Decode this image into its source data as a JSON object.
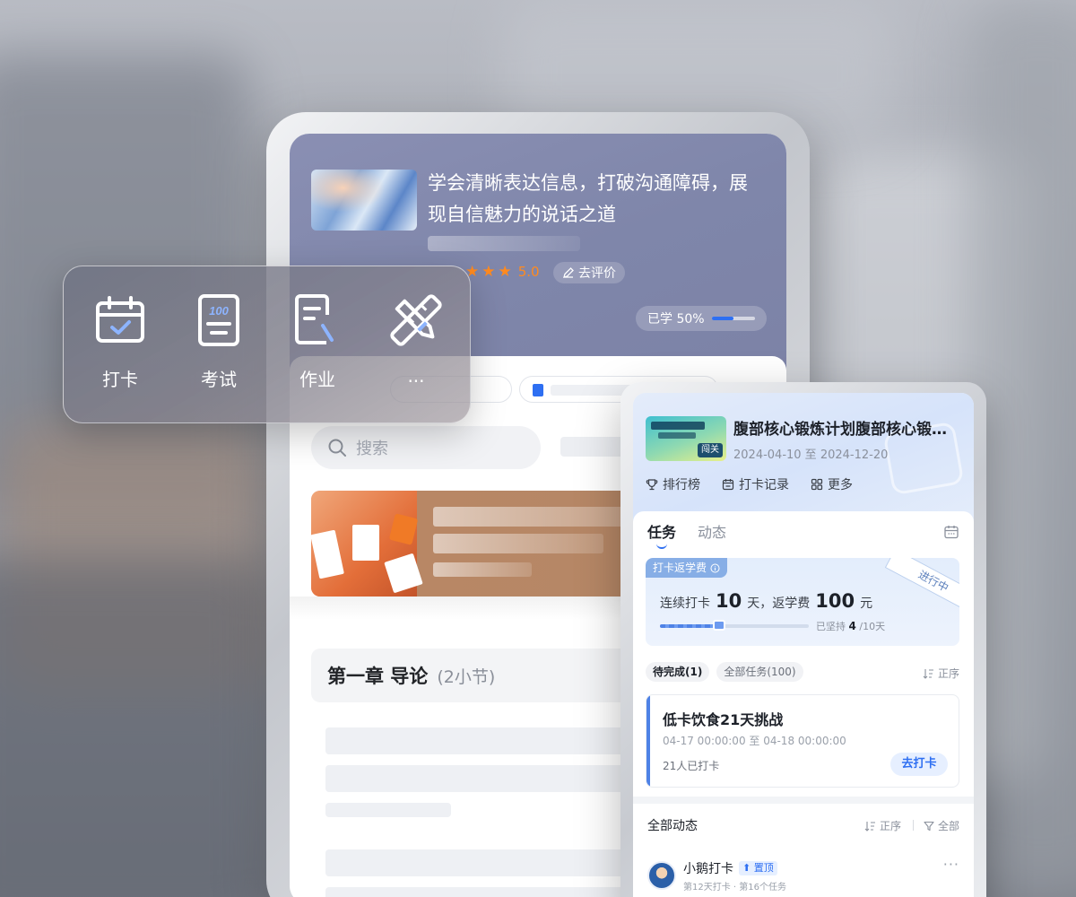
{
  "course": {
    "title": "学会清晰表达信息，打破沟通障碍，展现自信魅力的说话之道",
    "rating_score": "5.0",
    "rating": 5,
    "review_label": "去评价",
    "learned_label": "已学 50%",
    "learned_fraction": 0.5,
    "search_placeholder": "搜索",
    "chapter_title": "第一章 导论",
    "chapter_count": "(2小节)"
  },
  "actions": [
    {
      "label": "打卡",
      "icon": "calendar-check-icon"
    },
    {
      "label": "考试",
      "icon": "exam-icon"
    },
    {
      "label": "作业",
      "icon": "homework-icon"
    },
    {
      "label": "...",
      "icon": "tools-icon"
    }
  ],
  "camp": {
    "thumb_tag": "闯关",
    "title": "腹部核心锻炼计划腹部核心锻炼计划",
    "date_range": "2024-04-10 至 2024-12-20",
    "links": {
      "ranking": "排行榜",
      "records": "打卡记录",
      "more": "更多"
    },
    "tabs": {
      "tasks": "任务",
      "feed": "动态"
    }
  },
  "refund": {
    "tag": "打卡返学费",
    "status": "进行中",
    "prefix": "连续打卡",
    "days": "10",
    "days_unit": "天，返学费",
    "amount": "100",
    "amount_unit": "元",
    "kept_prefix": "已坚持",
    "kept_days": "4",
    "kept_suffix": "/10天",
    "progress_fraction": 0.4
  },
  "filters": {
    "pending": "待完成(1)",
    "all": "全部任务(100)",
    "sort": "正序"
  },
  "task": {
    "title": "低卡饮食21天挑战",
    "time": "04-17 00:00:00 至 04-18 00:00:00",
    "count": "21人已打卡",
    "button": "去打卡"
  },
  "feed": {
    "title": "全部动态",
    "sort": "正序",
    "filter": "全部",
    "poster": "小鹅打卡",
    "pin": "置顶",
    "meta": "第12天打卡 · 第16个任务",
    "more": "···"
  },
  "colors": {
    "accent": "#2e6ff2",
    "star": "#ff8a1f"
  }
}
